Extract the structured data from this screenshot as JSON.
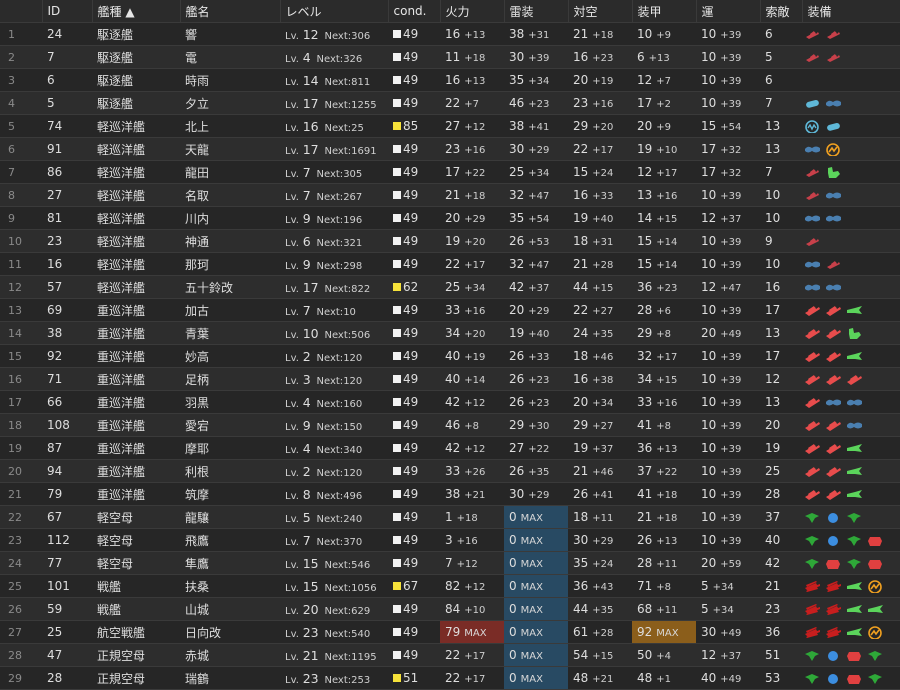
{
  "columns": [
    {
      "key": "rownum",
      "label": ""
    },
    {
      "key": "id",
      "label": "ID"
    },
    {
      "key": "type",
      "label": "艦種 ▲"
    },
    {
      "key": "name",
      "label": "艦名"
    },
    {
      "key": "level",
      "label": "レベル"
    },
    {
      "key": "cond",
      "label": "cond."
    },
    {
      "key": "firepower",
      "label": "火力"
    },
    {
      "key": "torpedo",
      "label": "雷装"
    },
    {
      "key": "aa",
      "label": "対空"
    },
    {
      "key": "armor",
      "label": "装甲"
    },
    {
      "key": "luck",
      "label": "運"
    },
    {
      "key": "search",
      "label": "索敵"
    },
    {
      "key": "equip",
      "label": "装備"
    }
  ],
  "labels": {
    "lv": "Lv.",
    "next": "Next:",
    "max": "MAX"
  },
  "icon_colors": {
    "small-gun": "#c8404a",
    "medium-gun": "#e84c4c",
    "large-gun": "#c81e1e",
    "secondary-gun": "#f0e040",
    "torpedo": "#4a7fb0",
    "aa-gun": "#5bd45b",
    "fighter": "#2ea838",
    "bomber": "#e04040",
    "torpedo-bomber": "#3c8ee0",
    "radar": "#f0a020",
    "sonar": "#5fb8d8",
    "drum": "#5fb8d8",
    "seaplane": "#5bd45b",
    "ammo": "#eaa020"
  },
  "rows": [
    {
      "n": "1",
      "id": "24",
      "type": "駆逐艦",
      "name": "響",
      "lv": "12",
      "next": "306",
      "cond": "49",
      "cy": false,
      "fp": "16",
      "fpi": "+13",
      "tp": "38",
      "tpi": "+31",
      "aa": "21",
      "aai": "+18",
      "ar": "10",
      "ari": "+9",
      "lk": "10",
      "lki": "+39",
      "sr": "6",
      "eq": [
        "small-gun",
        "small-gun"
      ]
    },
    {
      "n": "2",
      "id": "7",
      "type": "駆逐艦",
      "name": "電",
      "lv": "4",
      "next": "326",
      "cond": "49",
      "cy": false,
      "fp": "11",
      "fpi": "+18",
      "tp": "30",
      "tpi": "+39",
      "aa": "16",
      "aai": "+23",
      "ar": "6",
      "ari": "+13",
      "lk": "10",
      "lki": "+39",
      "sr": "5",
      "eq": [
        "small-gun",
        "small-gun"
      ]
    },
    {
      "n": "3",
      "id": "6",
      "type": "駆逐艦",
      "name": "時雨",
      "lv": "14",
      "next": "811",
      "cond": "49",
      "cy": false,
      "fp": "16",
      "fpi": "+13",
      "tp": "35",
      "tpi": "+34",
      "aa": "20",
      "aai": "+19",
      "ar": "12",
      "ari": "+7",
      "lk": "10",
      "lki": "+39",
      "sr": "6",
      "eq": []
    },
    {
      "n": "4",
      "id": "5",
      "type": "駆逐艦",
      "name": "夕立",
      "lv": "17",
      "next": "1255",
      "cond": "49",
      "cy": false,
      "fp": "22",
      "fpi": "+7",
      "tp": "46",
      "tpi": "+23",
      "aa": "23",
      "aai": "+16",
      "ar": "17",
      "ari": "+2",
      "lk": "10",
      "lki": "+39",
      "sr": "7",
      "eq": [
        "drum",
        "torpedo"
      ]
    },
    {
      "n": "5",
      "id": "74",
      "type": "軽巡洋艦",
      "name": "北上",
      "lv": "16",
      "next": "25",
      "cond": "85",
      "cy": true,
      "fp": "27",
      "fpi": "+12",
      "tp": "38",
      "tpi": "+41",
      "aa": "29",
      "aai": "+20",
      "ar": "20",
      "ari": "+9",
      "lk": "15",
      "lki": "+54",
      "sr": "13",
      "eq": [
        "sonar",
        "drum"
      ]
    },
    {
      "n": "6",
      "id": "91",
      "type": "軽巡洋艦",
      "name": "天龍",
      "lv": "17",
      "next": "1691",
      "cond": "49",
      "cy": false,
      "fp": "23",
      "fpi": "+16",
      "tp": "30",
      "tpi": "+29",
      "aa": "22",
      "aai": "+17",
      "ar": "19",
      "ari": "+10",
      "lk": "17",
      "lki": "+32",
      "sr": "13",
      "eq": [
        "torpedo",
        "radar"
      ]
    },
    {
      "n": "7",
      "id": "86",
      "type": "軽巡洋艦",
      "name": "龍田",
      "lv": "7",
      "next": "305",
      "cond": "49",
      "cy": false,
      "fp": "17",
      "fpi": "+22",
      "tp": "25",
      "tpi": "+34",
      "aa": "15",
      "aai": "+24",
      "ar": "12",
      "ari": "+17",
      "lk": "17",
      "lki": "+32",
      "sr": "7",
      "eq": [
        "small-gun",
        "aa-gun"
      ]
    },
    {
      "n": "8",
      "id": "27",
      "type": "軽巡洋艦",
      "name": "名取",
      "lv": "7",
      "next": "267",
      "cond": "49",
      "cy": false,
      "fp": "21",
      "fpi": "+18",
      "tp": "32",
      "tpi": "+47",
      "aa": "16",
      "aai": "+33",
      "ar": "13",
      "ari": "+16",
      "lk": "10",
      "lki": "+39",
      "sr": "10",
      "eq": [
        "small-gun",
        "torpedo"
      ]
    },
    {
      "n": "9",
      "id": "81",
      "type": "軽巡洋艦",
      "name": "川内",
      "lv": "9",
      "next": "196",
      "cond": "49",
      "cy": false,
      "fp": "20",
      "fpi": "+29",
      "tp": "35",
      "tpi": "+54",
      "aa": "19",
      "aai": "+40",
      "ar": "14",
      "ari": "+15",
      "lk": "12",
      "lki": "+37",
      "sr": "10",
      "eq": [
        "torpedo",
        "torpedo"
      ]
    },
    {
      "n": "10",
      "id": "23",
      "type": "軽巡洋艦",
      "name": "神通",
      "lv": "6",
      "next": "321",
      "cond": "49",
      "cy": false,
      "fp": "19",
      "fpi": "+20",
      "tp": "26",
      "tpi": "+53",
      "aa": "18",
      "aai": "+31",
      "ar": "15",
      "ari": "+14",
      "lk": "10",
      "lki": "+39",
      "sr": "9",
      "eq": [
        "small-gun"
      ]
    },
    {
      "n": "11",
      "id": "16",
      "type": "軽巡洋艦",
      "name": "那珂",
      "lv": "9",
      "next": "298",
      "cond": "49",
      "cy": false,
      "fp": "22",
      "fpi": "+17",
      "tp": "32",
      "tpi": "+47",
      "aa": "21",
      "aai": "+28",
      "ar": "15",
      "ari": "+14",
      "lk": "10",
      "lki": "+39",
      "sr": "10",
      "eq": [
        "torpedo",
        "small-gun"
      ]
    },
    {
      "n": "12",
      "id": "57",
      "type": "軽巡洋艦",
      "name": "五十鈴改",
      "lv": "17",
      "next": "822",
      "cond": "62",
      "cy": true,
      "fp": "25",
      "fpi": "+34",
      "tp": "42",
      "tpi": "+37",
      "aa": "44",
      "aai": "+15",
      "ar": "36",
      "ari": "+23",
      "lk": "12",
      "lki": "+47",
      "sr": "16",
      "eq": [
        "torpedo",
        "torpedo"
      ]
    },
    {
      "n": "13",
      "id": "69",
      "type": "重巡洋艦",
      "name": "加古",
      "lv": "7",
      "next": "10",
      "cond": "49",
      "cy": false,
      "fp": "33",
      "fpi": "+16",
      "tp": "20",
      "tpi": "+29",
      "aa": "22",
      "aai": "+27",
      "ar": "28",
      "ari": "+6",
      "lk": "10",
      "lki": "+39",
      "sr": "17",
      "eq": [
        "medium-gun",
        "medium-gun",
        "seaplane"
      ]
    },
    {
      "n": "14",
      "id": "38",
      "type": "重巡洋艦",
      "name": "青葉",
      "lv": "10",
      "next": "506",
      "cond": "49",
      "cy": false,
      "fp": "34",
      "fpi": "+20",
      "tp": "19",
      "tpi": "+40",
      "aa": "24",
      "aai": "+35",
      "ar": "29",
      "ari": "+8",
      "lk": "20",
      "lki": "+49",
      "sr": "13",
      "eq": [
        "medium-gun",
        "medium-gun",
        "aa-gun"
      ]
    },
    {
      "n": "15",
      "id": "92",
      "type": "重巡洋艦",
      "name": "妙高",
      "lv": "2",
      "next": "120",
      "cond": "49",
      "cy": false,
      "fp": "40",
      "fpi": "+19",
      "tp": "26",
      "tpi": "+33",
      "aa": "18",
      "aai": "+46",
      "ar": "32",
      "ari": "+17",
      "lk": "10",
      "lki": "+39",
      "sr": "17",
      "eq": [
        "medium-gun",
        "medium-gun",
        "seaplane"
      ]
    },
    {
      "n": "16",
      "id": "71",
      "type": "重巡洋艦",
      "name": "足柄",
      "lv": "3",
      "next": "120",
      "cond": "49",
      "cy": false,
      "fp": "40",
      "fpi": "+14",
      "tp": "26",
      "tpi": "+23",
      "aa": "16",
      "aai": "+38",
      "ar": "34",
      "ari": "+15",
      "lk": "10",
      "lki": "+39",
      "sr": "12",
      "eq": [
        "medium-gun",
        "medium-gun",
        "medium-gun"
      ]
    },
    {
      "n": "17",
      "id": "66",
      "type": "重巡洋艦",
      "name": "羽黒",
      "lv": "4",
      "next": "160",
      "cond": "49",
      "cy": false,
      "fp": "42",
      "fpi": "+12",
      "tp": "26",
      "tpi": "+23",
      "aa": "20",
      "aai": "+34",
      "ar": "33",
      "ari": "+16",
      "lk": "10",
      "lki": "+39",
      "sr": "13",
      "eq": [
        "medium-gun",
        "torpedo",
        "torpedo"
      ]
    },
    {
      "n": "18",
      "id": "108",
      "type": "重巡洋艦",
      "name": "愛宕",
      "lv": "9",
      "next": "150",
      "cond": "49",
      "cy": false,
      "fp": "46",
      "fpi": "+8",
      "tp": "29",
      "tpi": "+30",
      "aa": "29",
      "aai": "+27",
      "ar": "41",
      "ari": "+8",
      "lk": "10",
      "lki": "+39",
      "sr": "20",
      "eq": [
        "medium-gun",
        "medium-gun",
        "torpedo"
      ]
    },
    {
      "n": "19",
      "id": "87",
      "type": "重巡洋艦",
      "name": "摩耶",
      "lv": "4",
      "next": "340",
      "cond": "49",
      "cy": false,
      "fp": "42",
      "fpi": "+12",
      "tp": "27",
      "tpi": "+22",
      "aa": "19",
      "aai": "+37",
      "ar": "36",
      "ari": "+13",
      "lk": "10",
      "lki": "+39",
      "sr": "19",
      "eq": [
        "medium-gun",
        "medium-gun",
        "seaplane"
      ]
    },
    {
      "n": "20",
      "id": "94",
      "type": "重巡洋艦",
      "name": "利根",
      "lv": "2",
      "next": "120",
      "cond": "49",
      "cy": false,
      "fp": "33",
      "fpi": "+26",
      "tp": "26",
      "tpi": "+35",
      "aa": "21",
      "aai": "+46",
      "ar": "37",
      "ari": "+22",
      "lk": "10",
      "lki": "+39",
      "sr": "25",
      "eq": [
        "medium-gun",
        "medium-gun",
        "seaplane"
      ]
    },
    {
      "n": "21",
      "id": "79",
      "type": "重巡洋艦",
      "name": "筑摩",
      "lv": "8",
      "next": "496",
      "cond": "49",
      "cy": false,
      "fp": "38",
      "fpi": "+21",
      "tp": "30",
      "tpi": "+29",
      "aa": "26",
      "aai": "+41",
      "ar": "41",
      "ari": "+18",
      "lk": "10",
      "lki": "+39",
      "sr": "28",
      "eq": [
        "medium-gun",
        "medium-gun",
        "seaplane"
      ]
    },
    {
      "n": "22",
      "id": "67",
      "type": "軽空母",
      "name": "龍驤",
      "lv": "5",
      "next": "240",
      "cond": "49",
      "cy": false,
      "fp": "1",
      "fpi": "+18",
      "tp": "0",
      "tpi": "MAX",
      "tmax": true,
      "aa": "18",
      "aai": "+11",
      "ar": "21",
      "ari": "+18",
      "lk": "10",
      "lki": "+39",
      "sr": "37",
      "eq": [
        "fighter",
        "torpedo-bomber",
        "fighter"
      ]
    },
    {
      "n": "23",
      "id": "112",
      "type": "軽空母",
      "name": "飛鷹",
      "lv": "7",
      "next": "370",
      "cond": "49",
      "cy": false,
      "fp": "3",
      "fpi": "+16",
      "tp": "0",
      "tpi": "MAX",
      "tmax": true,
      "aa": "30",
      "aai": "+29",
      "ar": "26",
      "ari": "+13",
      "lk": "10",
      "lki": "+39",
      "sr": "40",
      "eq": [
        "fighter",
        "torpedo-bomber",
        "fighter",
        "bomber"
      ]
    },
    {
      "n": "24",
      "id": "77",
      "type": "軽空母",
      "name": "隼鷹",
      "lv": "15",
      "next": "546",
      "cond": "49",
      "cy": false,
      "fp": "7",
      "fpi": "+12",
      "tp": "0",
      "tpi": "MAX",
      "tmax": true,
      "aa": "35",
      "aai": "+24",
      "ar": "28",
      "ari": "+11",
      "lk": "20",
      "lki": "+59",
      "sr": "42",
      "eq": [
        "fighter",
        "bomber",
        "fighter",
        "bomber"
      ]
    },
    {
      "n": "25",
      "id": "101",
      "type": "戦艦",
      "name": "扶桑",
      "lv": "15",
      "next": "1056",
      "cond": "67",
      "cy": true,
      "fp": "82",
      "fpi": "+12",
      "tp": "0",
      "tpi": "MAX",
      "tmax": true,
      "aa": "36",
      "aai": "+43",
      "ar": "71",
      "ari": "+8",
      "lk": "5",
      "lki": "+34",
      "sr": "21",
      "eq": [
        "large-gun",
        "large-gun",
        "seaplane",
        "radar"
      ]
    },
    {
      "n": "26",
      "id": "59",
      "type": "戦艦",
      "name": "山城",
      "lv": "20",
      "next": "629",
      "cond": "49",
      "cy": false,
      "fp": "84",
      "fpi": "+10",
      "tp": "0",
      "tpi": "MAX",
      "tmax": true,
      "aa": "44",
      "aai": "+35",
      "ar": "68",
      "ari": "+11",
      "lk": "5",
      "lki": "+34",
      "sr": "23",
      "eq": [
        "large-gun",
        "large-gun",
        "seaplane",
        "seaplane"
      ]
    },
    {
      "n": "27",
      "id": "25",
      "type": "航空戦艦",
      "name": "日向改",
      "lv": "23",
      "next": "540",
      "cond": "49",
      "cy": false,
      "fp": "79",
      "fpi": "MAX",
      "fmax": true,
      "tp": "0",
      "tpi": "MAX",
      "tmax": true,
      "aa": "61",
      "aai": "+28",
      "ar": "92",
      "ari": "MAX",
      "amax": true,
      "lk": "30",
      "lki": "+49",
      "sr": "36",
      "eq": [
        "large-gun",
        "large-gun",
        "seaplane",
        "radar"
      ]
    },
    {
      "n": "28",
      "id": "47",
      "type": "正規空母",
      "name": "赤城",
      "lv": "21",
      "next": "1195",
      "cond": "49",
      "cy": false,
      "fp": "22",
      "fpi": "+17",
      "tp": "0",
      "tpi": "MAX",
      "tmax": true,
      "aa": "54",
      "aai": "+15",
      "ar": "50",
      "ari": "+4",
      "lk": "12",
      "lki": "+37",
      "sr": "51",
      "eq": [
        "fighter",
        "torpedo-bomber",
        "bomber",
        "fighter"
      ]
    },
    {
      "n": "29",
      "id": "28",
      "type": "正規空母",
      "name": "瑞鶴",
      "lv": "23",
      "next": "253",
      "cond": "51",
      "cy": true,
      "fp": "22",
      "fpi": "+17",
      "tp": "0",
      "tpi": "MAX",
      "tmax": true,
      "aa": "48",
      "aai": "+21",
      "ar": "48",
      "ari": "+1",
      "lk": "40",
      "lki": "+49",
      "sr": "53",
      "eq": [
        "fighter",
        "torpedo-bomber",
        "bomber",
        "fighter"
      ]
    }
  ]
}
